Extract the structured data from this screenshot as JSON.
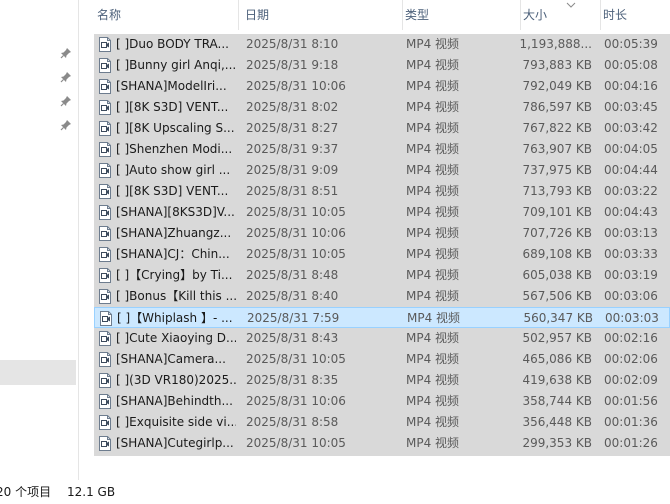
{
  "header": {
    "name": "名称",
    "date": "日期",
    "type": "类型",
    "size": "大小",
    "duration": "时长"
  },
  "files": [
    {
      "name": "[ ]Duo BODY TRA...",
      "date": "2025/8/31 8:10",
      "type": "MP4 视频",
      "size": "1,193,888...",
      "duration": "00:05:39"
    },
    {
      "name": "[ ]Bunny girl Anqi,...",
      "date": "2025/8/31 9:18",
      "type": "MP4 视频",
      "size": "793,883 KB",
      "duration": "00:05:08"
    },
    {
      "name": "[SHANA]ModelIri...",
      "date": "2025/8/31 10:06",
      "type": "MP4 视频",
      "size": "792,049 KB",
      "duration": "00:04:16"
    },
    {
      "name": "[ ][8K S3D] VENT...",
      "date": "2025/8/31 8:02",
      "type": "MP4 视频",
      "size": "786,597 KB",
      "duration": "00:03:45"
    },
    {
      "name": "[ ][8K Upscaling S...",
      "date": "2025/8/31 8:27",
      "type": "MP4 视频",
      "size": "767,822 KB",
      "duration": "00:03:42"
    },
    {
      "name": "[ ]Shenzhen Modi...",
      "date": "2025/8/31 9:37",
      "type": "MP4 视频",
      "size": "763,907 KB",
      "duration": "00:04:05"
    },
    {
      "name": "[ ]Auto show girl ...",
      "date": "2025/8/31 9:09",
      "type": "MP4 视频",
      "size": "737,975 KB",
      "duration": "00:04:44"
    },
    {
      "name": "[ ][8K S3D] VENT...",
      "date": "2025/8/31 8:51",
      "type": "MP4 视频",
      "size": "713,793 KB",
      "duration": "00:03:22"
    },
    {
      "name": "[SHANA][8KS3D]V...",
      "date": "2025/8/31 10:05",
      "type": "MP4 视频",
      "size": "709,101 KB",
      "duration": "00:04:43"
    },
    {
      "name": "[SHANA]Zhuangz...",
      "date": "2025/8/31 10:06",
      "type": "MP4 视频",
      "size": "707,726 KB",
      "duration": "00:03:13"
    },
    {
      "name": "[SHANA]CJ：Chin...",
      "date": "2025/8/31 10:05",
      "type": "MP4 视频",
      "size": "689,108 KB",
      "duration": "00:03:33"
    },
    {
      "name": "[ ]【Crying】by Ti...",
      "date": "2025/8/31 8:48",
      "type": "MP4 视频",
      "size": "605,038 KB",
      "duration": "00:03:19"
    },
    {
      "name": "[ ]Bonus【Kill this ...",
      "date": "2025/8/31 8:40",
      "type": "MP4 视频",
      "size": "567,506 KB",
      "duration": "00:03:06"
    },
    {
      "name": "[ ]【Whiplash 】- ...",
      "date": "2025/8/31 7:59",
      "type": "MP4 视频",
      "size": "560,347 KB",
      "duration": "00:03:03",
      "selected": true
    },
    {
      "name": "[ ]Cute Xiaoying D...",
      "date": "2025/8/31 8:43",
      "type": "MP4 视频",
      "size": "502,957 KB",
      "duration": "00:02:16"
    },
    {
      "name": "[SHANA]Camera...",
      "date": "2025/8/31 10:05",
      "type": "MP4 视频",
      "size": "465,086 KB",
      "duration": "00:02:06"
    },
    {
      "name": "[ ](3D VR180)2025...",
      "date": "2025/8/31 8:35",
      "type": "MP4 视频",
      "size": "419,638 KB",
      "duration": "00:02:09"
    },
    {
      "name": "[SHANA]Behindth...",
      "date": "2025/8/31 10:06",
      "type": "MP4 视频",
      "size": "358,744 KB",
      "duration": "00:01:56"
    },
    {
      "name": "[ ]Exquisite side vi...",
      "date": "2025/8/31 8:58",
      "type": "MP4 视频",
      "size": "356,448 KB",
      "duration": "00:01:36"
    },
    {
      "name": "[SHANA]Cutegirlp...",
      "date": "2025/8/31 10:05",
      "type": "MP4 视频",
      "size": "299,353 KB",
      "duration": "00:01:26"
    }
  ],
  "status": {
    "count": "20 个项目",
    "total": "12.1 GB"
  },
  "colors": {
    "selection": "#cce8ff",
    "selection_border": "#99d1ff",
    "header_text": "#4c607a",
    "row_bg": "#d9d9d9"
  },
  "icons": {
    "pin": "pin-icon",
    "file": "video-file-icon",
    "sort": "sort-caret-icon"
  }
}
